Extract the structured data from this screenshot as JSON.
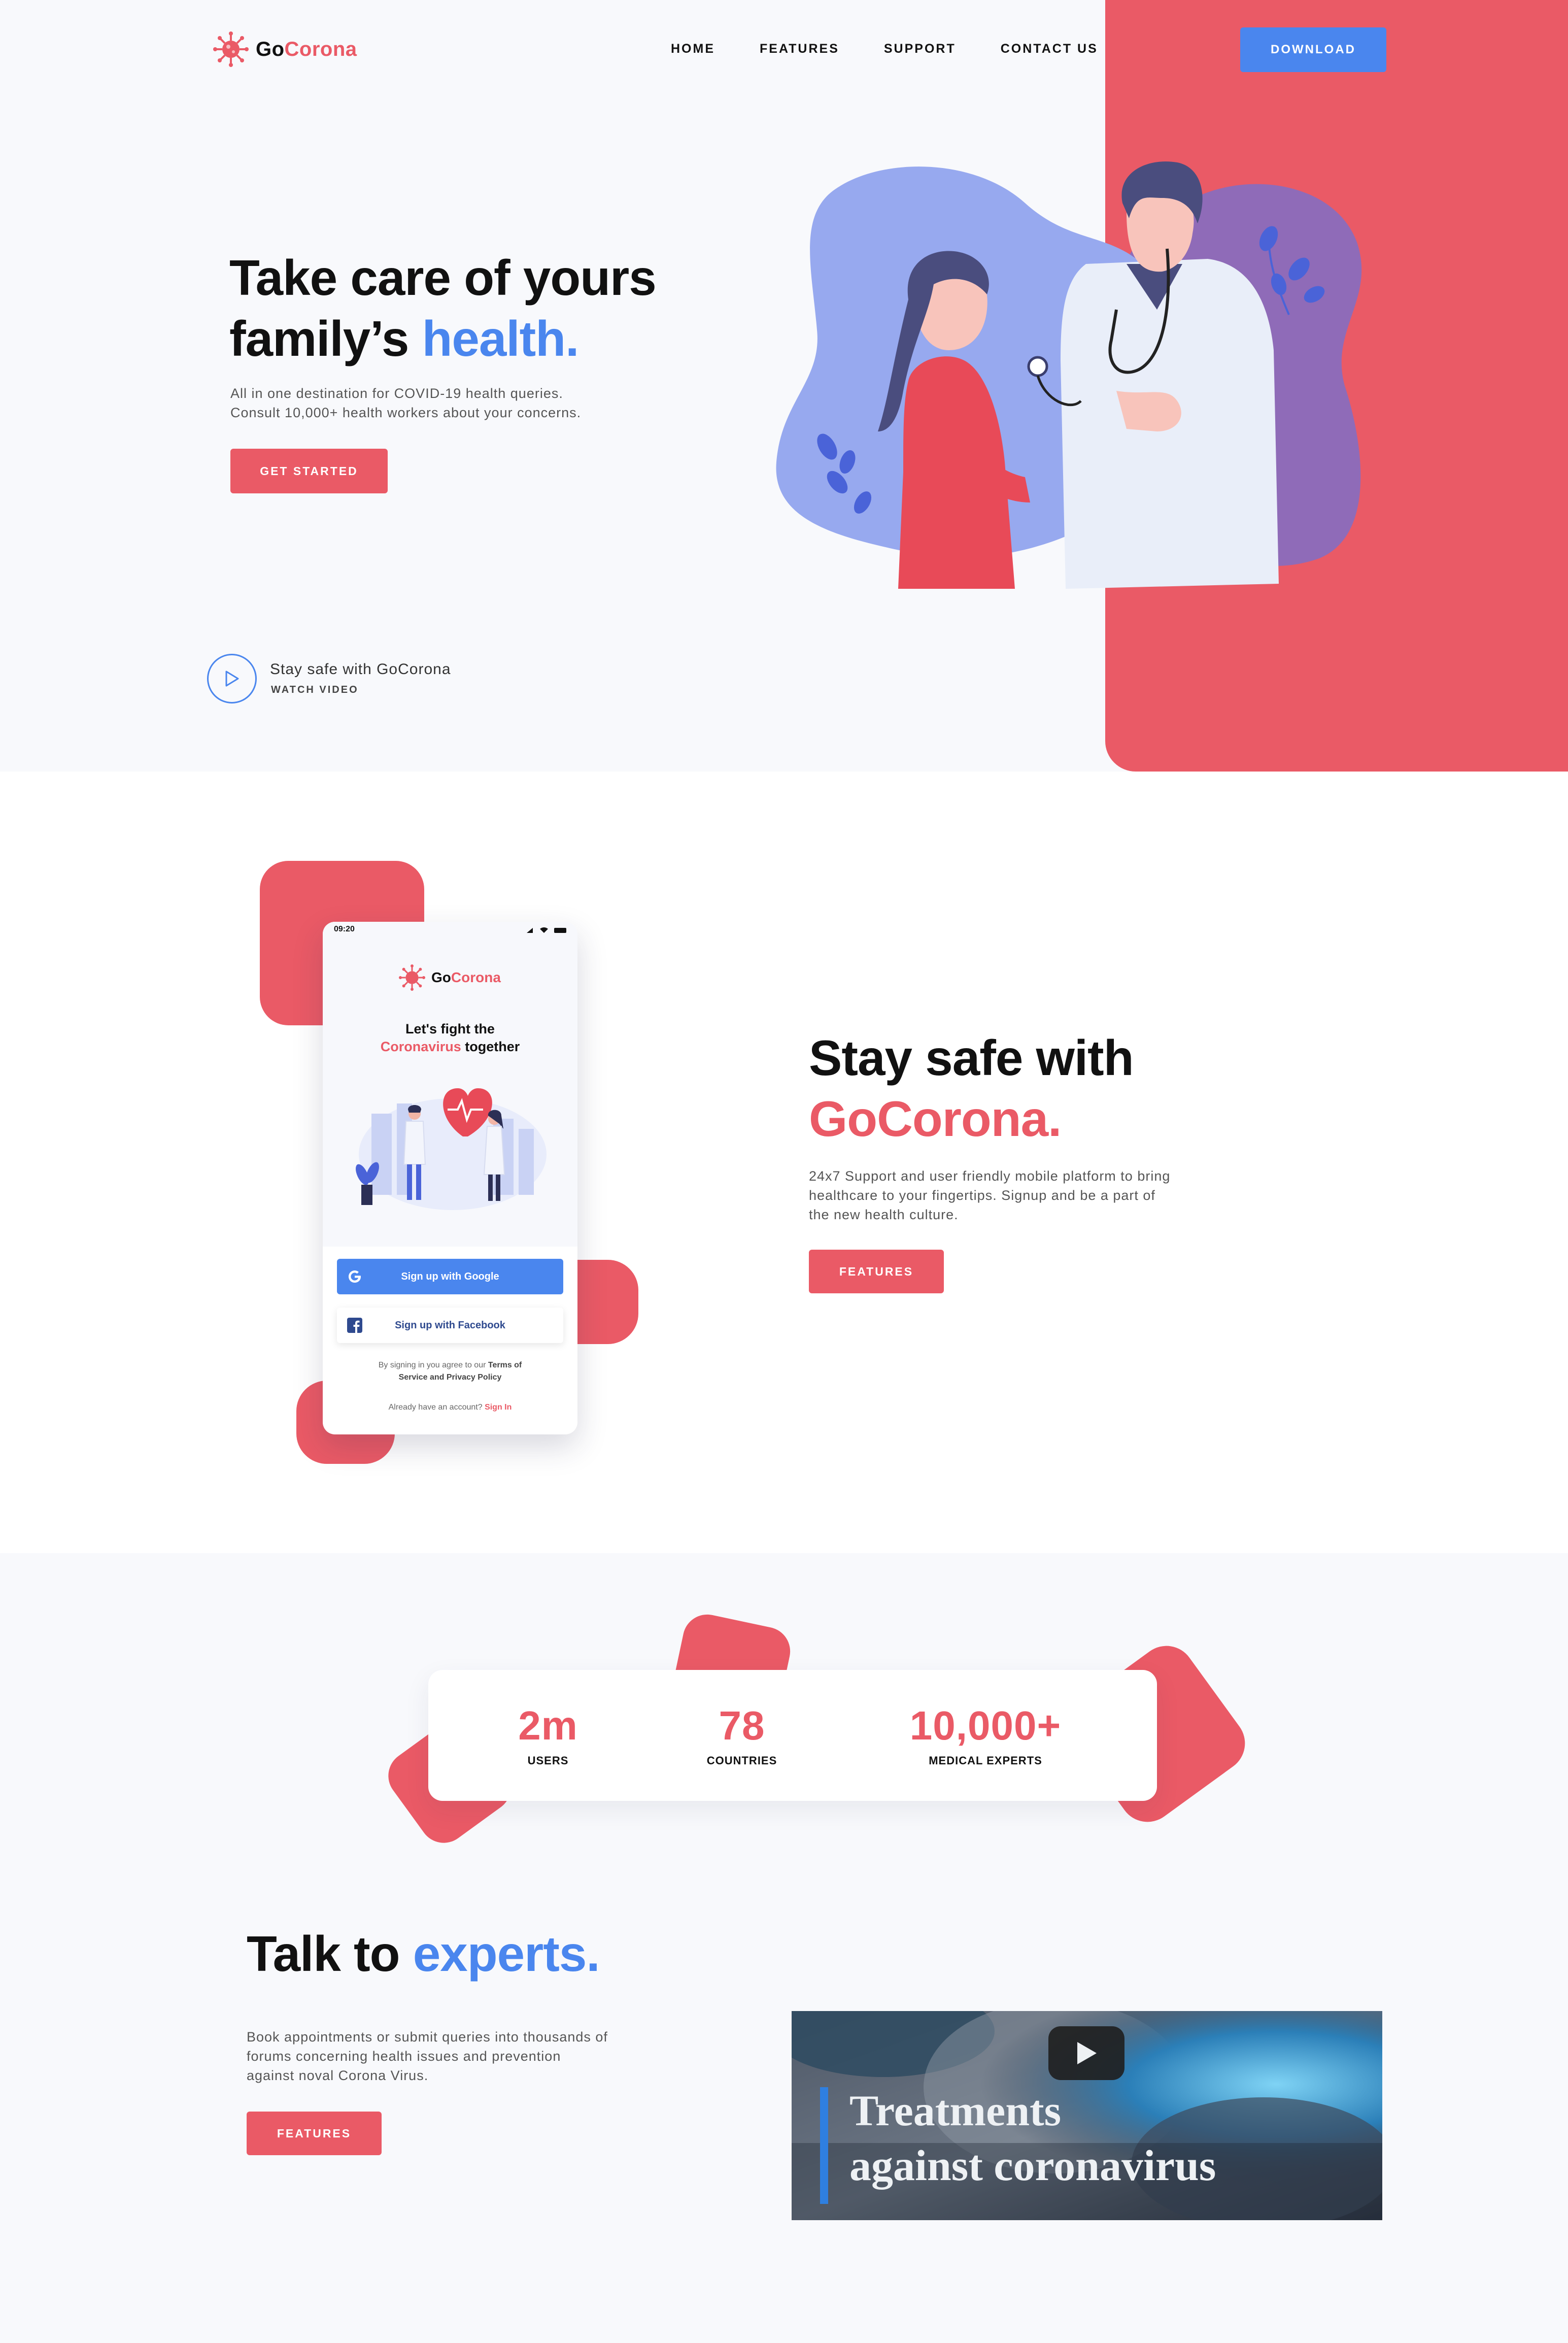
{
  "brand": {
    "go": "Go",
    "corona": "Corona"
  },
  "nav": {
    "items": [
      "HOME",
      "FEATURES",
      "SUPPORT",
      "CONTACT US"
    ],
    "download": "DOWNLOAD"
  },
  "hero": {
    "title_line1": "Take care of yours",
    "title_line2_prefix": "family’s ",
    "title_line2_highlight": "health.",
    "desc_line1": "All in one destination for COVID-19 health queries.",
    "desc_line2": "Consult 10,000+ health workers about your concerns.",
    "cta": "GET STARTED",
    "video_title": "Stay safe with GoCorona",
    "video_sub": "WATCH VIDEO"
  },
  "phone": {
    "time": "09:20",
    "brand_go": "Go",
    "brand_corona": "Corona",
    "headline_line1": "Let's fight the",
    "headline_red": "Coronavirus",
    "headline_rest": " together",
    "google": "Sign up with Google",
    "facebook": "Sign up with Facebook",
    "terms_prefix": "By signing in you agree to our ",
    "terms_bold1": "Terms of",
    "terms_bold2": "Service and Privacy Policy",
    "account": "Already have an account? ",
    "sign_in": "Sign In"
  },
  "safe": {
    "title_line1": "Stay safe with",
    "title_line2": "GoCorona.",
    "desc_line1": "24x7 Support and user friendly mobile platform to bring",
    "desc_line2": "healthcare to your fingertips. Signup and be a part of",
    "desc_line3": "the new health culture.",
    "cta": "FEATURES"
  },
  "stats": [
    {
      "value": "2m",
      "label": "USERS"
    },
    {
      "value": "78",
      "label": "COUNTRIES"
    },
    {
      "value": "10,000+",
      "label": "MEDICAL EXPERTS"
    }
  ],
  "experts": {
    "title_prefix": "Talk to ",
    "title_highlight": "experts.",
    "desc_line1": "Book appointments or submit queries into thousands of",
    "desc_line2": "forums concerning health issues and prevention",
    "desc_line3": "against noval Corona Virus.",
    "cta": "FEATURES",
    "video_line1": "Treatments",
    "video_line2": "against coronavirus"
  },
  "colors": {
    "red": "#ea5a66",
    "blue": "#4a86ee",
    "purple": "#8f6bb8",
    "periwinkle": "#97a9ef"
  },
  "icons": [
    "virus-logo-icon",
    "play-icon",
    "google-icon",
    "facebook-icon",
    "youtube-play-icon"
  ]
}
